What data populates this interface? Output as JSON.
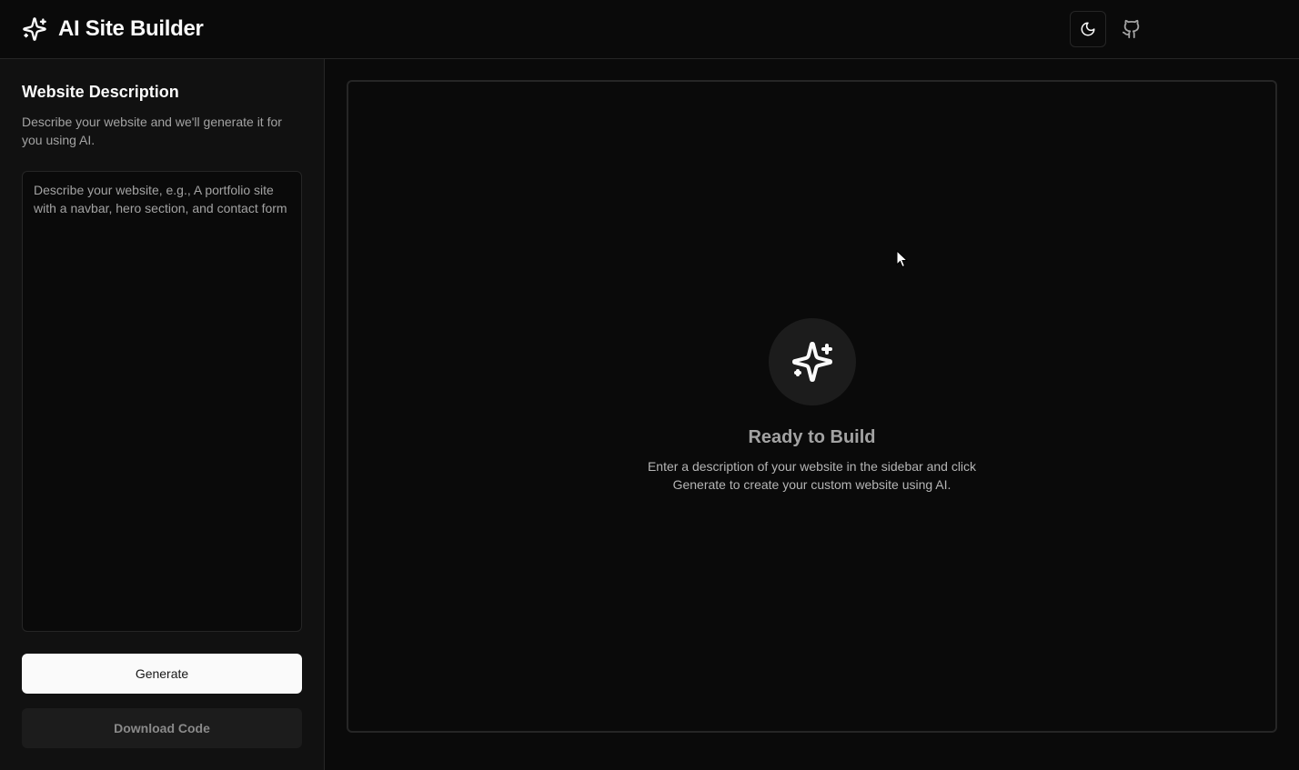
{
  "header": {
    "app_title": "AI Site Builder",
    "logo_icon": "sparkles-icon",
    "theme_toggle_icon": "moon-icon",
    "github_icon": "github-icon"
  },
  "sidebar": {
    "title": "Website Description",
    "description": "Describe your website and we'll generate it for you using AI.",
    "prompt": {
      "value": "",
      "placeholder": "Describe your website, e.g., A portfolio site with a navbar, hero section, and contact form"
    },
    "generate_label": "Generate",
    "download_label": "Download Code"
  },
  "preview": {
    "empty_icon": "sparkles-icon",
    "empty_title": "Ready to Build",
    "empty_description": "Enter a description of your website in the sidebar and click Generate to create your custom website using AI."
  },
  "colors": {
    "background": "#0a0a0a",
    "sidebar_background": "#111111",
    "border": "#262626",
    "primary_button": "#fafafa",
    "muted_text": "#a3a3a3"
  }
}
